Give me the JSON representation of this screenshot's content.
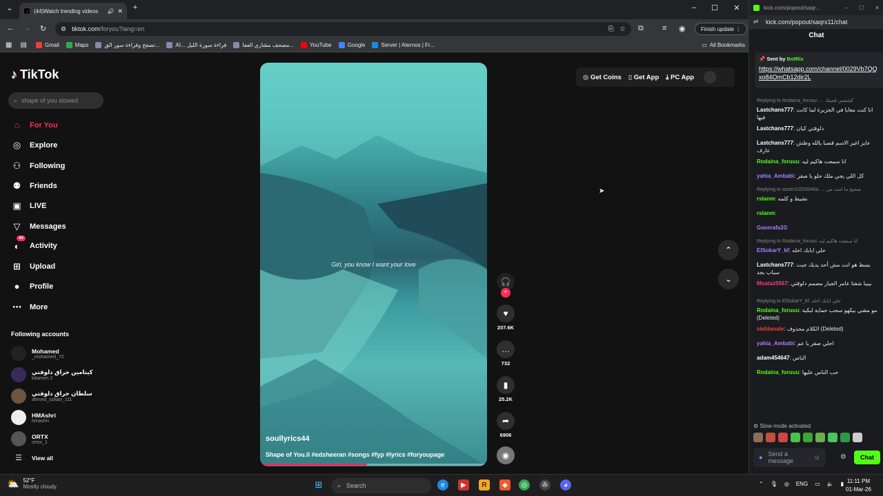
{
  "browser": {
    "tab_title": "(44)Watch trending videos",
    "url_host": "tiktok.com",
    "url_path": "/foryou?lang=en",
    "finish_update": "Finish update",
    "bookmarks": [
      {
        "label": "Gmail",
        "color": "#ea4335"
      },
      {
        "label": "Maps",
        "color": "#34a853"
      },
      {
        "label": "تصفح وقراءة سور الق...",
        "color": "#8888aa"
      },
      {
        "label": "AI... قراءة سورة الليل",
        "color": "#8888aa"
      },
      {
        "label": "مصحف مشاري العفا...",
        "color": "#8888aa"
      },
      {
        "label": "YouTube",
        "color": "#ff0000"
      },
      {
        "label": "Google",
        "color": "#4285f4"
      },
      {
        "label": "Server | Aternos | Fr...",
        "color": "#1e88e5"
      }
    ],
    "all_bookmarks": "All Bookmarks"
  },
  "tiktok": {
    "logo": "TikTok",
    "search_placeholder": "shape of you slowed",
    "nav": [
      {
        "label": "For You",
        "icon": "home-icon",
        "glyph": "⌂",
        "active": true
      },
      {
        "label": "Explore",
        "icon": "compass-icon",
        "glyph": "◎"
      },
      {
        "label": "Following",
        "icon": "following-icon",
        "glyph": "⚇"
      },
      {
        "label": "Friends",
        "icon": "friends-icon",
        "glyph": "⚉"
      },
      {
        "label": "LIVE",
        "icon": "live-icon",
        "glyph": "▣"
      },
      {
        "label": "Messages",
        "icon": "messages-icon",
        "glyph": "▽"
      },
      {
        "label": "Activity",
        "icon": "activity-icon",
        "glyph": "◐",
        "badge": "44"
      },
      {
        "label": "Upload",
        "icon": "upload-icon",
        "glyph": "⊞"
      },
      {
        "label": "Profile",
        "icon": "profile-icon",
        "glyph": "●"
      },
      {
        "label": "More",
        "icon": "more-icon",
        "glyph": "⋯"
      }
    ],
    "following_heading": "Following accounts",
    "accounts": [
      {
        "name": "Mohamed",
        "handle": "_mohamed_72"
      },
      {
        "name": "كيتامين حراق دلوقتي",
        "handle": "kitamen.2"
      },
      {
        "name": "سلطان حراق دلوقتي",
        "handle": "ahmed_soltan_111"
      },
      {
        "name": "HMAshri",
        "handle": "hmashri"
      },
      {
        "name": "ORTX",
        "handle": "ortxx_1"
      }
    ],
    "view_all": "View all",
    "video": {
      "lyric": "Girl, you know I want your love",
      "username": "soullyrics44",
      "caption": "Shape of You.ll #edsheeran #songs #fyp #lyrics #foryoupage",
      "progress": 0.47
    },
    "actions": {
      "likes": "207.6K",
      "comments": "732",
      "saves": "25.2K",
      "shares": "6906"
    },
    "top": {
      "coins": "Get Coins",
      "app": "Get App",
      "pc": "PC App"
    }
  },
  "kick": {
    "title": "kick.com/popout/saqr...",
    "address": "kick.com/popout/saqrx11/chat",
    "chat_heading": "Chat",
    "pinned_sent_by": "Sent by",
    "pinned_user": "BotRix",
    "pinned_link": "https://whatsapp.com/channel/0029Vb7QQxo84OmCb12dir2L",
    "messages": [
      {
        "type": "reply",
        "text": "Replying to Rodaina_foruuu: ... كشفس قصتك"
      },
      {
        "type": "msg",
        "user": "Lastchans777",
        "color": "#ffffff",
        "text": "انا كنت معايا في الجزيرة لما كانت فيها"
      },
      {
        "type": "msg",
        "user": "Lastchans777",
        "color": "#ffffff",
        "text": "دلوقتي كيان"
      },
      {
        "type": "msg",
        "user": "Lastchans777",
        "color": "#ffffff",
        "text": "عايز اغير الاسم قصبا يالله وطش عارف"
      },
      {
        "type": "msg",
        "user": "Rodaina_foruuu",
        "color": "#53fc18",
        "text": "انا سمعت هاكيم ليه"
      },
      {
        "type": "msg",
        "user": "yahia_Ambabi",
        "color": "#b17cff",
        "text": "كل اللي يجي ملك حلو يا صقر"
      },
      {
        "type": "reply",
        "text": "Replying to asser10203040a: ... صحيح ما امت من"
      },
      {
        "type": "msg",
        "user": "rslanm",
        "color": "#53fc18",
        "text": "نشيط و كلمه"
      },
      {
        "type": "msg",
        "user": "rslanm",
        "color": "#53fc18",
        "text": ""
      },
      {
        "type": "msg",
        "user": "Gaserafa33",
        "color": "#b17cff",
        "text": ""
      },
      {
        "type": "reply",
        "text": "Replying to Rodaina_foruuu: انا سمعت هاكيم ليه"
      },
      {
        "type": "msg",
        "user": "ElSokarY_kf",
        "color": "#b17cff",
        "text": "خلي ابابك اخله"
      },
      {
        "type": "msg",
        "user": "Lastchans777",
        "color": "#ffffff",
        "text": "بسط هو انت مش أحد يديك جبت سباب بجد"
      },
      {
        "type": "msg",
        "user": "Moataz5567",
        "color": "#ff3b7a",
        "text": "بيبيا شفتا عامر الجيار مصمم دلوقتي"
      },
      {
        "type": "reply",
        "text": "Replying to ElSokarY_kf: خلي ابابك اخله"
      },
      {
        "type": "msg",
        "user": "Rodaina_foruuu",
        "color": "#53fc18",
        "text": "مو مشي بيكهو سحب حماية لبكية (Deleted)"
      },
      {
        "type": "msg",
        "user": "siefdanale",
        "color": "#ff3b3b",
        "text": "الكلام محذوف (Deleted)"
      },
      {
        "type": "msg",
        "user": "yahia_Ambabi",
        "color": "#b17cff",
        "text": "احلي صقر يا عم"
      },
      {
        "type": "msg",
        "user": "adam454647",
        "color": "#ffffff",
        "text": "الناس"
      },
      {
        "type": "msg",
        "user": "Rodaina_foruuu",
        "color": "#53fc18",
        "text": "حب الناس عليها"
      }
    ],
    "slow_mode": "Slow mode activated",
    "input_placeholder": "Send a message",
    "chat_button": "Chat"
  },
  "taskbar": {
    "temp": "52°F",
    "condition": "Mostly cloudy",
    "search": "Search",
    "lang": "ENG",
    "time": "11:11 PM",
    "date": "01-Mar-26"
  }
}
